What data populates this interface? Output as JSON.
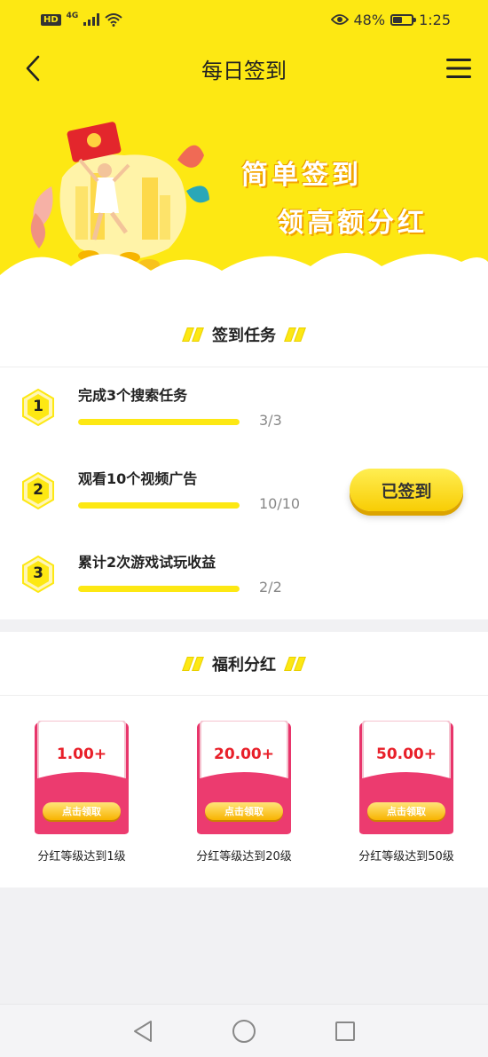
{
  "status_bar": {
    "hd": "HD",
    "network": "4G",
    "battery_percent": "48%",
    "battery_level": 0.48,
    "time": "1:25"
  },
  "nav": {
    "title": "每日签到",
    "back_icon": "chevron-left-icon",
    "menu_icon": "hamburger-menu-icon"
  },
  "banner": {
    "line1": "简单签到",
    "line2": "领高额分红"
  },
  "tasks_section": {
    "title": "签到任务",
    "tasks": [
      {
        "number": "1",
        "label": "完成3个搜索任务",
        "progress": "3/3",
        "ratio": 1.0
      },
      {
        "number": "2",
        "label": "观看10个视频广告",
        "progress": "10/10",
        "ratio": 1.0
      },
      {
        "number": "3",
        "label": "累计2次游戏试玩收益",
        "progress": "2/2",
        "ratio": 1.0
      }
    ],
    "signed_button": "已签到"
  },
  "bonus_section": {
    "title": "福利分红",
    "items": [
      {
        "amount": "1.00+",
        "button": "点击领取",
        "label": "分红等级达到1级"
      },
      {
        "amount": "20.00+",
        "button": "点击领取",
        "label": "分红等级达到20级"
      },
      {
        "amount": "50.00+",
        "button": "点击领取",
        "label": "分红等级达到50级"
      }
    ]
  },
  "colors": {
    "brand_yellow": "#fde813",
    "envelope_pink": "#e8356b",
    "amount_red": "#e8202a"
  },
  "system_nav": {
    "back": "triangle-back-icon",
    "home": "circle-home-icon",
    "recents": "square-recents-icon"
  }
}
